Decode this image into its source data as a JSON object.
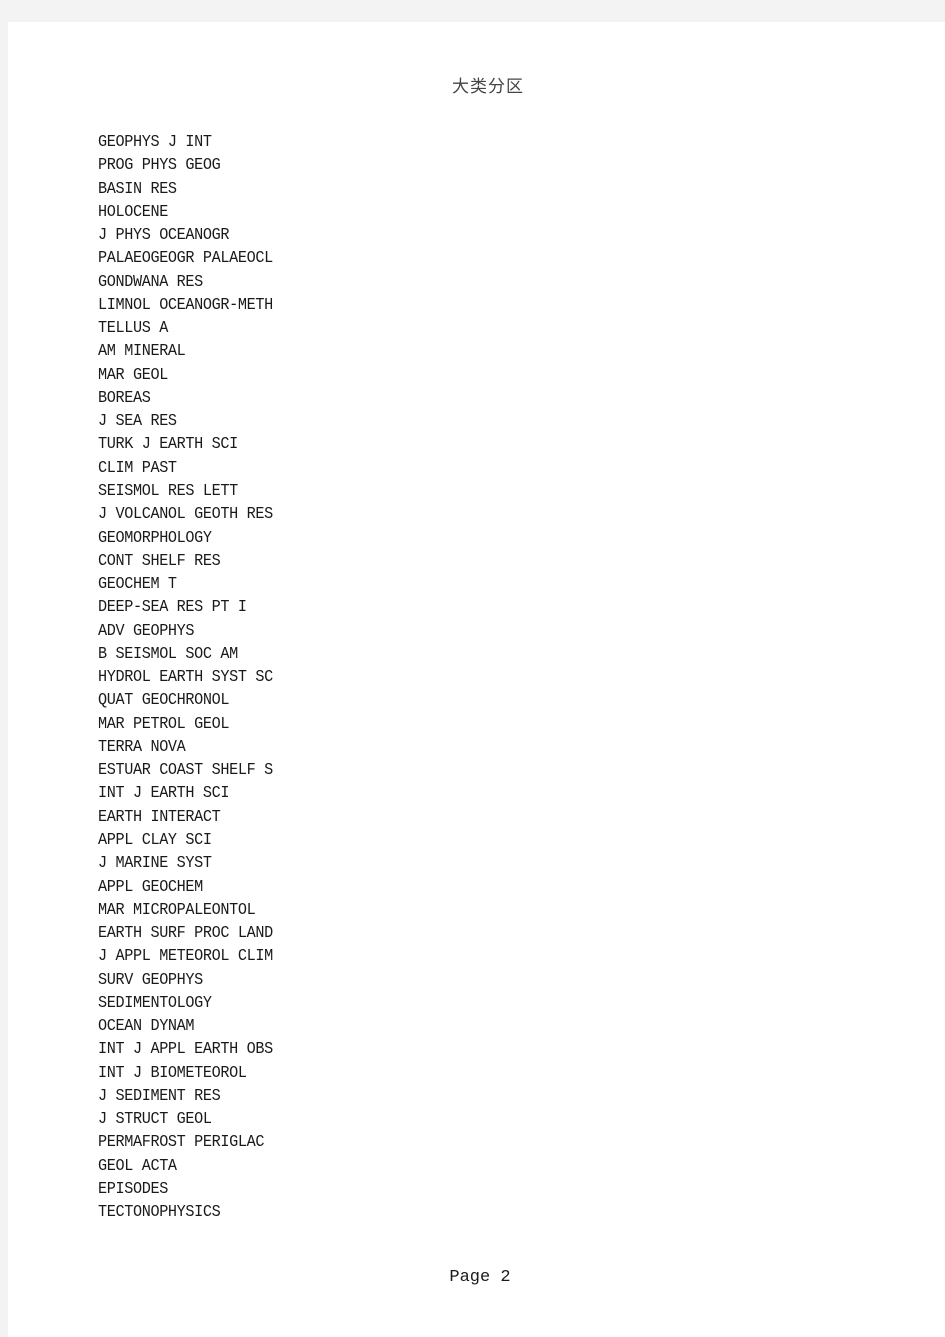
{
  "header": {
    "title": "大类分区"
  },
  "journals": [
    "GEOPHYS J INT",
    "PROG PHYS GEOG",
    "BASIN RES",
    "HOLOCENE",
    "J PHYS OCEANOGR",
    "PALAEOGEOGR PALAEOCL",
    "GONDWANA RES",
    "LIMNOL OCEANOGR-METH",
    "TELLUS A",
    "AM MINERAL",
    "MAR GEOL",
    "BOREAS",
    "J SEA RES",
    "TURK J EARTH SCI",
    "CLIM PAST",
    "SEISMOL RES LETT",
    "J VOLCANOL GEOTH RES",
    "GEOMORPHOLOGY",
    "CONT SHELF RES",
    "GEOCHEM T",
    "DEEP-SEA RES PT I",
    "ADV GEOPHYS",
    "B SEISMOL SOC AM",
    "HYDROL EARTH SYST SC",
    "QUAT GEOCHRONOL",
    "MAR PETROL GEOL",
    "TERRA NOVA",
    "ESTUAR COAST SHELF S",
    "INT J EARTH SCI",
    "EARTH INTERACT",
    "APPL CLAY SCI",
    "J MARINE SYST",
    "APPL GEOCHEM",
    "MAR MICROPALEONTOL",
    "EARTH SURF PROC LAND",
    "J APPL METEOROL CLIM",
    "SURV GEOPHYS",
    "SEDIMENTOLOGY",
    "OCEAN DYNAM",
    "INT J APPL EARTH OBS",
    "INT J BIOMETEOROL",
    "J SEDIMENT RES",
    "J STRUCT GEOL",
    "PERMAFROST PERIGLAC",
    "GEOL ACTA",
    "EPISODES",
    "TECTONOPHYSICS"
  ],
  "footer": {
    "page_label": "Page 2"
  }
}
